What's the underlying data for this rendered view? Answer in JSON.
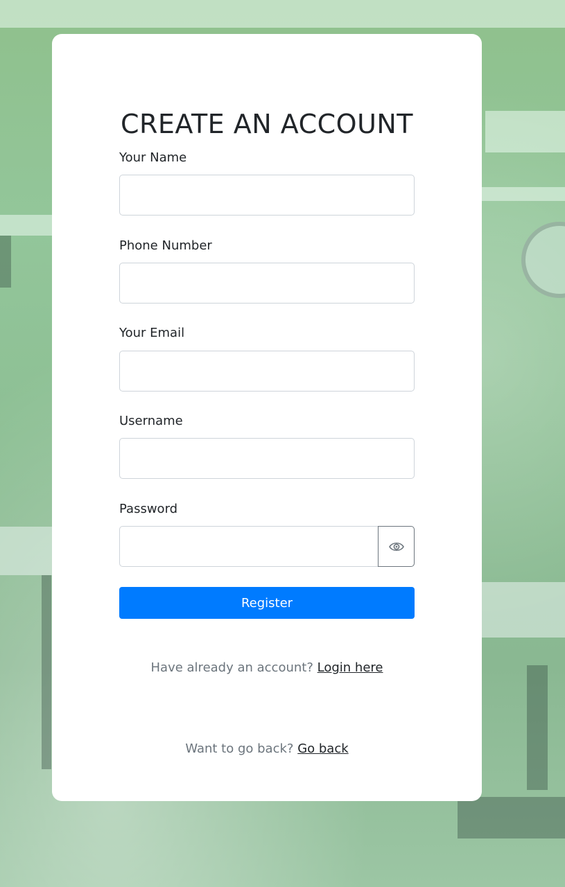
{
  "form": {
    "title": "CREATE AN ACCOUNT",
    "fields": {
      "name": {
        "label": "Your Name",
        "value": ""
      },
      "phone": {
        "label": "Phone Number",
        "value": ""
      },
      "email": {
        "label": "Your Email",
        "value": ""
      },
      "username": {
        "label": "Username",
        "value": ""
      },
      "password": {
        "label": "Password",
        "value": "",
        "toggle_icon": "eye-icon"
      }
    },
    "register_label": "Register"
  },
  "footer": {
    "login_prompt": "Have already an account?",
    "login_link": "Login here",
    "back_prompt": "Want to go back?",
    "back_link": "Go back"
  },
  "colors": {
    "primary": "#007bff",
    "background_tint": "#8fc08c",
    "card": "#ffffff"
  }
}
